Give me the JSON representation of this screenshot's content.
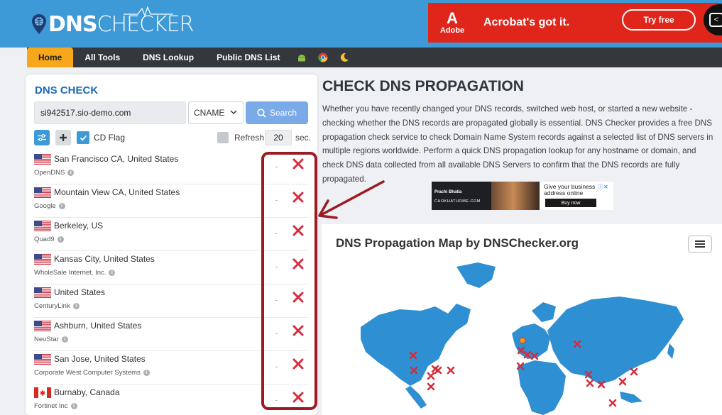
{
  "header": {
    "logo": {
      "bold": "DNS",
      "light": "CHECKER"
    },
    "ad": {
      "brand": "Adobe",
      "headline": "Acrobat's got it.",
      "cta": "Try free",
      "color": "#e0261b"
    }
  },
  "nav": {
    "items": [
      "Home",
      "All Tools",
      "DNS Lookup",
      "Public DNS List"
    ],
    "active": "Home",
    "icons": [
      "android-icon",
      "chrome-icon",
      "moon-icon"
    ]
  },
  "dns_check": {
    "title": "DNS CHECK",
    "domain_value": "si942517.sio-demo.com",
    "record_type": "CNAME",
    "search_label": "Search",
    "cd_flag_label": "CD Flag",
    "refresh_label": "Refresh:",
    "refresh_value": "20",
    "sec_label": "sec.",
    "servers": [
      {
        "location": "San Francisco CA, United States",
        "provider": "OpenDNS",
        "flag": "us",
        "value": "-"
      },
      {
        "location": "Mountain View CA, United States",
        "provider": "Google",
        "flag": "us",
        "value": "-"
      },
      {
        "location": "Berkeley, US",
        "provider": "Quad9",
        "flag": "us",
        "value": "-"
      },
      {
        "location": "Kansas City, United States",
        "provider": "WholeSale Internet, Inc.",
        "flag": "us",
        "value": "-"
      },
      {
        "location": "United States",
        "provider": "CenturyLink",
        "flag": "us",
        "value": "-"
      },
      {
        "location": "Ashburn, United States",
        "provider": "NeuStar",
        "flag": "us",
        "value": "-"
      },
      {
        "location": "San Jose, United States",
        "provider": "Corporate West Computer Systems",
        "flag": "us",
        "value": "-"
      },
      {
        "location": "Burnaby, Canada",
        "provider": "Fortinet Inc",
        "flag": "ca",
        "value": "-"
      }
    ]
  },
  "main": {
    "heading": "CHECK DNS PROPAGATION",
    "description": "Whether you have recently changed your DNS records, switched web host, or started a new website - checking whether the DNS records are propagated globally is essential. DNS Checker provides a free DNS propagation check service to check Domain Name System records against a selected list of DNS servers in multiple regions worldwide. Perform a quick DNS propagation lookup for any hostname or domain, and check DNS data collected from all available DNS Servers to confirm that the DNS records are fully propagated.",
    "ad2": {
      "name": "Prachi Bhatia",
      "site": "CHOKHATHOME.COM",
      "text": "Give your business address online",
      "cta": "Buy now"
    },
    "map_title": "DNS Propagation Map by DNSChecker.org"
  },
  "colors": {
    "brand": "#3d9ad6",
    "nav": "#34383d",
    "accent": "#f6a71c",
    "fail": "#d62b3a",
    "highlight": "#9b1b24"
  }
}
